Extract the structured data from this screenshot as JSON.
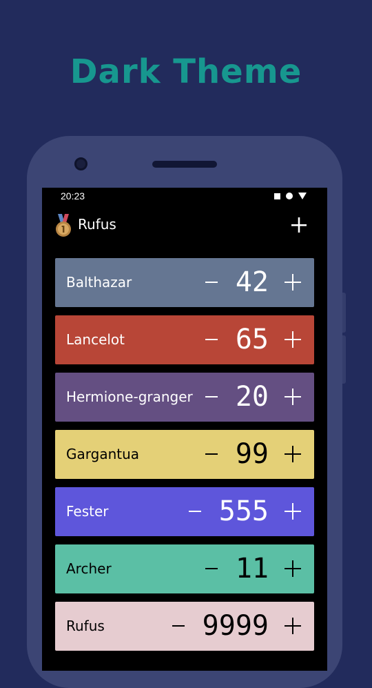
{
  "headline": {
    "text": "Dark Theme",
    "color": "#17978f"
  },
  "status_bar": {
    "time": "20:23",
    "icons": [
      "stop-square-icon",
      "circle-icon",
      "signal-triangle-icon"
    ]
  },
  "app_bar": {
    "title": "Rufus",
    "leading_icon": "medal-icon",
    "action_icon": "add-icon"
  },
  "players": [
    {
      "name": "Balthazar",
      "score": "42",
      "color": "#657692",
      "text_color": "#ffffff"
    },
    {
      "name": "Lancelot",
      "score": "65",
      "color": "#b84637",
      "text_color": "#ffffff"
    },
    {
      "name": "Hermione-granger",
      "score": "20",
      "color": "#644f82",
      "text_color": "#ffffff"
    },
    {
      "name": "Gargantua",
      "score": "99",
      "color": "#e4d077",
      "text_color": "#000000"
    },
    {
      "name": "Fester",
      "score": "555",
      "color": "#5e56db",
      "text_color": "#ffffff"
    },
    {
      "name": "Archer",
      "score": "11",
      "color": "#5bbfa5",
      "text_color": "#000000"
    },
    {
      "name": "Rufus",
      "score": "9999",
      "color": "#e6ccd0",
      "text_color": "#000000"
    }
  ]
}
